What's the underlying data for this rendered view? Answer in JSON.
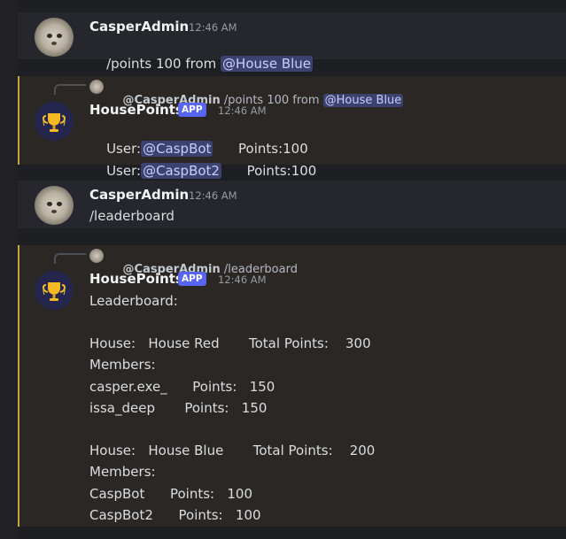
{
  "msg1": {
    "username": "CasperAdmin",
    "time": "12:46 AM",
    "text": "/points 100 from ",
    "mention": "@House Blue"
  },
  "msg2": {
    "reply_user": "@CasperAdmin",
    "reply_text": " /points 100 from ",
    "reply_mention": "@House Blue",
    "username": "HousePoints",
    "app_tag": "APP",
    "time": "12:46 AM",
    "lines": [
      {
        "prefix": "User:",
        "mention": "@CaspBot",
        "suffix": "      Points:100"
      },
      {
        "prefix": "User:",
        "mention": "@CaspBot2",
        "suffix": "      Points:100"
      }
    ]
  },
  "msg3": {
    "username": "CasperAdmin",
    "time": "12:46 AM",
    "text": "/leaderboard"
  },
  "msg4": {
    "reply_user": "@CasperAdmin",
    "reply_text": " /leaderboard",
    "username": "HousePoints",
    "app_tag": "APP",
    "time": "12:46 AM",
    "lines": [
      "Leaderboard:",
      "House:   House Red       Total Points:    300",
      "Members:",
      "casper.exe_      Points:   150",
      "issa_deep       Points:   150",
      "House:   House Blue       Total Points:    200",
      "Members:",
      "CaspBot      Points:   100",
      "CaspBot2      Points:   100"
    ]
  },
  "colors": {
    "accent_mention_bg": "#3c4270",
    "mention_text": "#c9cdfb",
    "app_tag": "#5865f2",
    "highlight_bar": "#c9a04b",
    "highlight_bg": "#2b2724"
  },
  "icons": {
    "bot_avatar": "trophy-icon",
    "user_avatar": "otter-avatar"
  }
}
